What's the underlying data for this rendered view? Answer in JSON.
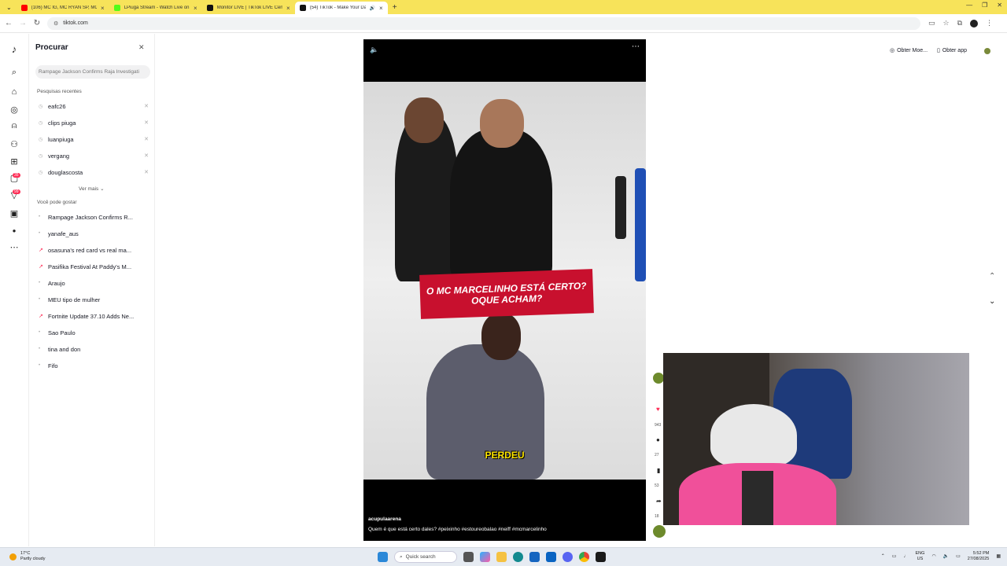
{
  "browser": {
    "tabs": [
      {
        "title": "(106) MC IG, MC RYAN SP, MC",
        "color": "#ff0000"
      },
      {
        "title": "LPiuga Stream - Watch Live on",
        "color": "#53fc18"
      },
      {
        "title": "Monitor LIVE | TikTok LIVE Cent",
        "color": "#111111"
      },
      {
        "title": "(54) TikTok - Make Your Day",
        "color": "#111111"
      }
    ],
    "url": "tiktok.com"
  },
  "search_panel": {
    "title": "Procurar",
    "placeholder": "Rampage Jackson Confirms Raja Investigati",
    "recent_label": "Pesquisas recentes",
    "recent": [
      "eafc26",
      "clips piuga",
      "luanpiuga",
      "vergang",
      "douglascosta"
    ],
    "see_more": "Ver mais",
    "suggest_label": "Você pode gostar",
    "suggestions": [
      {
        "text": "Rampage Jackson Confirms R...",
        "trending": false
      },
      {
        "text": "yanafe_aus",
        "trending": false
      },
      {
        "text": "osasuna's red card vs real ma...",
        "trending": true
      },
      {
        "text": "Pasifika Festival At Paddy's M...",
        "trending": true
      },
      {
        "text": "Araujo",
        "trending": false
      },
      {
        "text": "MEU tipo de mulher",
        "trending": false
      },
      {
        "text": "Fortnite Update 37.10 Adds Ne...",
        "trending": true
      },
      {
        "text": "Sao Paulo",
        "trending": false
      },
      {
        "text": "tina and don",
        "trending": false
      },
      {
        "text": "Fifo",
        "trending": false
      }
    ]
  },
  "rail": {
    "badges": [
      "35",
      "99"
    ]
  },
  "video": {
    "banner_line1": "O MC MARCELINHO ESTÁ CERTO?",
    "banner_line2": "OQUE ACHAM?",
    "caption_word": "PERDEU",
    "author": "acupulaarena",
    "description": "Quem é que está certo dales? #peixinho  #estoureobalao  #neiff  #mcmarcelinho"
  },
  "top_actions": {
    "get_coins": "Obter Moe...",
    "get_app": "Obter app"
  },
  "side_counts": [
    "943",
    "27",
    "53",
    "18"
  ],
  "taskbar": {
    "weather_temp": "17°C",
    "weather_desc": "Partly cloudy",
    "search_label": "Quick search",
    "lang_top": "ENG",
    "lang_bottom": "US",
    "time": "5:52 PM",
    "date": "27/08/2025"
  }
}
